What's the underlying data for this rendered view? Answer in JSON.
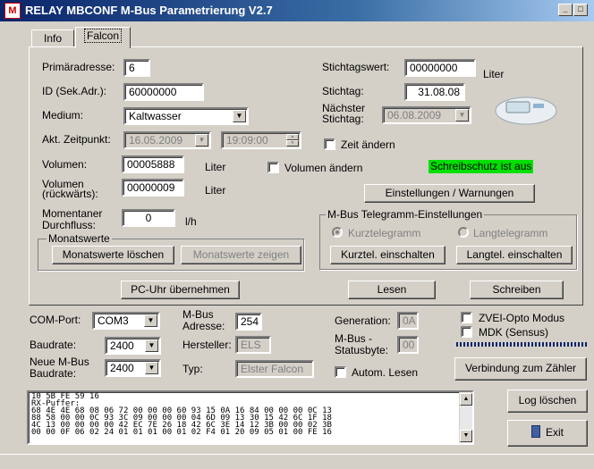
{
  "titlebar": {
    "icon_label": "M",
    "title": "RELAY MBCONF  M-Bus Parametrierung  V2.7"
  },
  "tabs": [
    {
      "label": "Info"
    },
    {
      "label": "Falcon"
    }
  ],
  "falcon": {
    "primaeradresse": {
      "label": "Primäradresse:",
      "value": "6"
    },
    "id": {
      "label": "ID (Sek.Adr.):",
      "value": "60000000"
    },
    "medium": {
      "label": "Medium:",
      "value": "Kaltwasser"
    },
    "zeitpunkt": {
      "label": "Akt. Zeitpunkt:",
      "date": "16.05.2009",
      "time": "19:09:00"
    },
    "volumen": {
      "label": "Volumen:",
      "value": "00005888",
      "unit": "Liter"
    },
    "volumen_rueck": {
      "label1": "Volumen",
      "label2": "(rückwärts):",
      "value": "00000009",
      "unit": "Liter"
    },
    "durchfluss": {
      "label1": "Momentaner",
      "label2": "Durchfluss:",
      "value": "0",
      "unit": "l/h"
    },
    "stichtagswert": {
      "label": "Stichtagswert:",
      "value": "00000000",
      "unit": "Liter"
    },
    "stichtag": {
      "label": "Stichtag:",
      "value": "31.08.08"
    },
    "naechster": {
      "label1": "Nächster",
      "label2": "Stichtag:",
      "value": "06.08.2009"
    },
    "zeit_aendern": "Zeit ändern",
    "volumen_aendern": "Volumen ändern",
    "schreibschutz": "Schreibschutz ist aus",
    "einstellungen_btn": "Einstellungen / Warnungen",
    "monatswerte": {
      "title": "Monatswerte",
      "loeschen": "Monatswerte löschen",
      "zeigen": "Monatswerte zeigen"
    },
    "telegramm": {
      "title": "M-Bus Telegramm-Einstellungen",
      "kurz_radio": "Kurztelegramm",
      "lang_radio": "Langtelegramm",
      "kurz_btn": "Kurztel. einschalten",
      "lang_btn": "Langtel. einschalten"
    },
    "pc_uhr": "PC-Uhr übernehmen",
    "lesen": "Lesen",
    "schreiben": "Schreiben"
  },
  "bottom": {
    "com_label": "COM-Port:",
    "com_value": "COM3",
    "baud_label": "Baudrate:",
    "baud_value": "2400",
    "neue_label1": "Neue M-Bus",
    "neue_label2": "Baudrate:",
    "neue_value": "2400",
    "mbus_adr_label1": "M-Bus",
    "mbus_adr_label2": "Adresse:",
    "mbus_adr_value": "254",
    "hersteller_label": "Hersteller:",
    "hersteller_value": "ELS",
    "typ_label": "Typ:",
    "typ_value": "Elster Falcon",
    "generation_label": "Generation:",
    "generation_value": "0A",
    "status_label1": "M-Bus -",
    "status_label2": "Statusbyte:",
    "status_value": "00",
    "zvei": "ZVEI-Opto Modus",
    "mdk": "MDK (Sensus)",
    "autom_lesen": "Autom. Lesen",
    "verbindung": "Verbindung zum Zähler",
    "log_loeschen": "Log löschen",
    "exit": "Exit"
  },
  "log_lines": [
    "10 5B FE 59 16",
    "RX-Puffer:",
    "68 4E 4E 68 08 06 72 00 00 00 60 93 15 0A 16 84 00 00 00 0C 13",
    "88 58 00 00 0C 93 3C 09 00 00 00 04 6D 09 13 30 15 42 6C 1F 18",
    "4C 13 00 00 00 00 42 EC 7E 26 18 42 6C 3E 14 12 3B 00 00 02 3B",
    "00 00 0F 06 02 24 01 01 01 00 01 02 F4 01 20 09 05 01 00 FE 16"
  ]
}
